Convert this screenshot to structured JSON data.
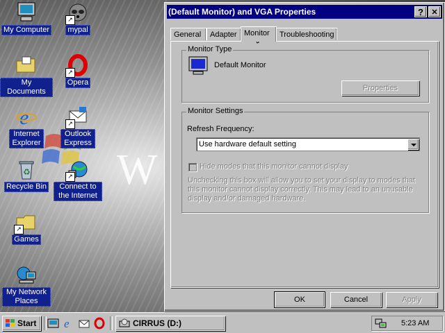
{
  "desktop": {
    "icons": [
      {
        "label": "My Computer",
        "icon": "computer-icon"
      },
      {
        "label": "mypal",
        "icon": "raccoon-icon"
      },
      {
        "label": "My Documents",
        "icon": "folder-documents-icon"
      },
      {
        "label": "Opera",
        "icon": "opera-icon"
      },
      {
        "label": "Internet Explorer",
        "icon": "ie-icon"
      },
      {
        "label": "Outlook Express",
        "icon": "outlook-icon"
      },
      {
        "label": "Recycle Bin",
        "icon": "recycle-bin-icon"
      },
      {
        "label": "Connect to the Internet",
        "icon": "connect-icon"
      },
      {
        "label": "Games",
        "icon": "folder-icon"
      },
      {
        "label": "My Network Places",
        "icon": "network-icon"
      }
    ],
    "background_text": "W"
  },
  "dialog": {
    "title": "(Default Monitor) and VGA Properties",
    "help_btn": "?",
    "close_btn": "✕",
    "tabs": [
      "General",
      "Adapter",
      "Monitor",
      "Troubleshooting"
    ],
    "active_tab": "Monitor",
    "monitor_type": {
      "group_title": "Monitor Type",
      "name": "Default Monitor",
      "properties_btn": "Properties"
    },
    "monitor_settings": {
      "group_title": "Monitor Settings",
      "refresh_label": "Refresh Frequency:",
      "refresh_value": "Use hardware default setting",
      "hide_modes_label": "Hide modes that this monitor cannot display",
      "hide_modes_checked": false,
      "description": "Unchecking this box will allow you to set your display to modes that this monitor cannot display correctly. This may lead to an unusable display and/or damaged hardware."
    },
    "buttons": {
      "ok": "OK",
      "cancel": "Cancel",
      "apply": "Apply"
    }
  },
  "taskbar": {
    "start": "Start",
    "quick_launch": [
      "show-desktop-icon",
      "ie-icon",
      "outlook-icon",
      "opera-icon"
    ],
    "task": "CIRRUS (D:)",
    "clock": "5:23 AM"
  },
  "colors": {
    "title_bar": "#000080",
    "face": "#c0c0c0",
    "icon_label_bg": "#10208c"
  }
}
